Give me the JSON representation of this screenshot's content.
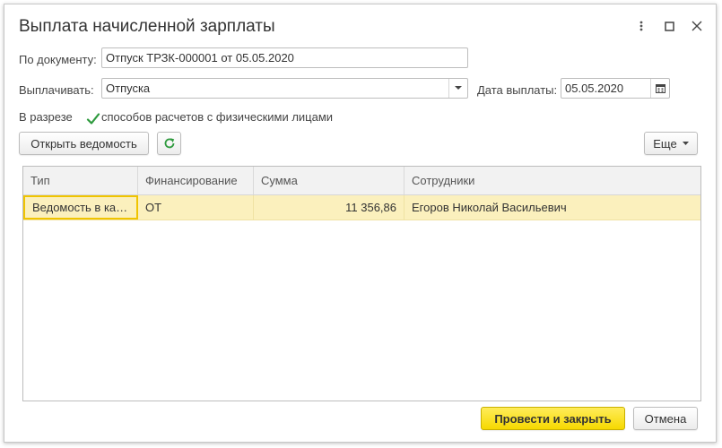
{
  "window": {
    "title": "Выплата начисленной зарплаты",
    "icons": [
      "more-vertical-icon",
      "maximize-icon",
      "close-icon"
    ]
  },
  "form": {
    "document_label": "По документу:",
    "document_value": "Отпуск ТРЗК-000001 от 05.05.2020",
    "pay_label": "Выплачивать:",
    "pay_value": "Отпуска",
    "date_label": "Дата выплаты:",
    "date_value": "05.05.2020",
    "breakdown_label": "В разрезе",
    "breakdown_checkbox_label": "способов расчетов с физическими лицами",
    "breakdown_checked": true
  },
  "toolbar": {
    "open_statement_label": "Открыть ведомость",
    "refresh_icon": "refresh-icon",
    "more_label": "Еще"
  },
  "table": {
    "columns": [
      "Тип",
      "Финансирование",
      "Сумма",
      "Сотрудники"
    ],
    "rows": [
      {
        "type": "Ведомость в кассу",
        "financing": "ОТ",
        "amount": "11 356,86",
        "employees": "Егоров Николай Васильевич"
      }
    ]
  },
  "footer": {
    "post_close_label": "Провести и закрыть",
    "cancel_label": "Отмена"
  },
  "colors": {
    "accent_button": "#f6d900",
    "selected_row": "#fbf0bd",
    "check_green": "#2e9a3e"
  }
}
